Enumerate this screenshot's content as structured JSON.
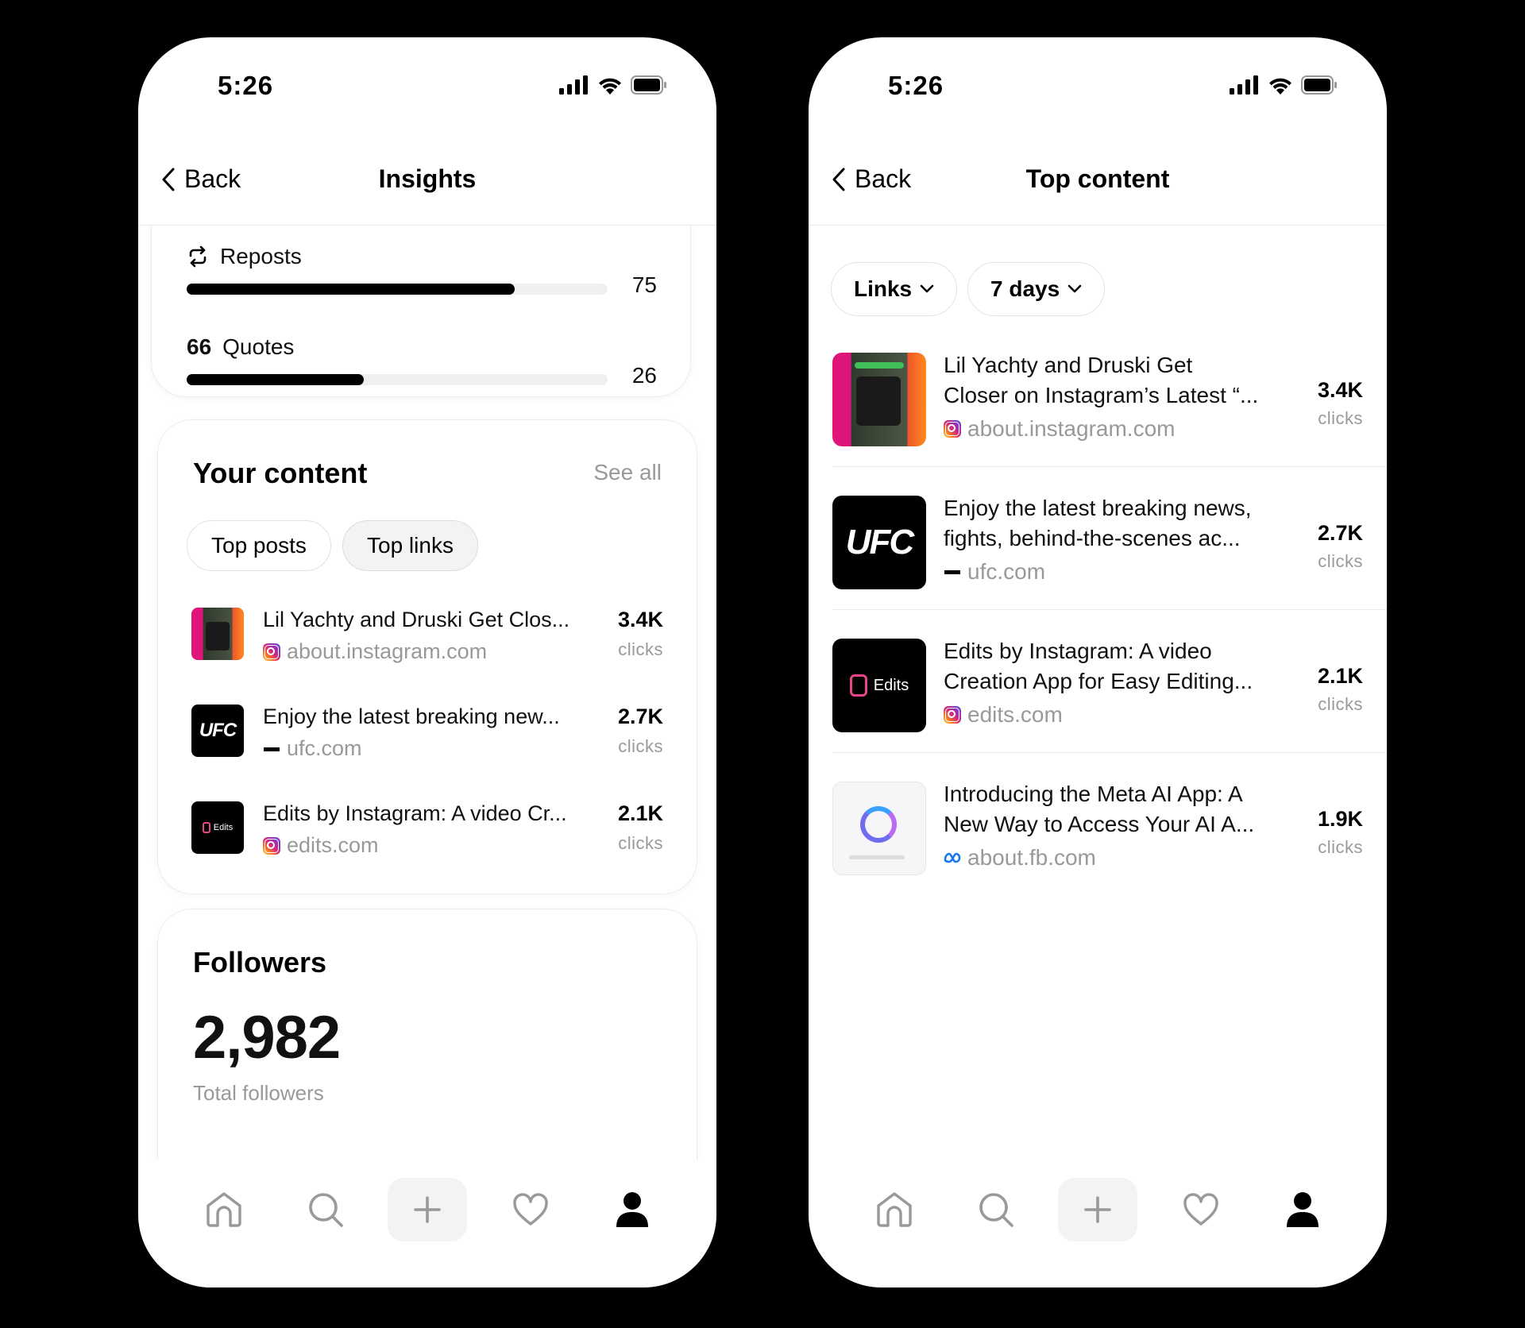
{
  "left_screen": {
    "status": {
      "time": "5:26"
    },
    "nav": {
      "back_label": "Back",
      "title": "Insights"
    },
    "interactions": {
      "reposts": {
        "label": "Reposts",
        "value": "75",
        "fraction": 0.78
      },
      "quotes": {
        "icon_text": "66",
        "label": "Quotes",
        "value": "26",
        "fraction": 0.42
      }
    },
    "your_content": {
      "title": "Your content",
      "see_all": "See all",
      "tabs": [
        {
          "label": "Top posts",
          "active": false
        },
        {
          "label": "Top links",
          "active": true
        }
      ],
      "items": [
        {
          "title": "Lil Yachty and Druski Get Clos...",
          "domain": "about.instagram.com",
          "count": "3.4K",
          "unit": "clicks",
          "thumb": "instagram-reel-thumbnail",
          "favicon": "instagram-icon"
        },
        {
          "title": "Enjoy the latest breaking new...",
          "domain": "ufc.com",
          "count": "2.7K",
          "unit": "clicks",
          "thumb": "ufc-logo",
          "favicon": "ufc-icon"
        },
        {
          "title": "Edits by Instagram: A video Cr...",
          "domain": "edits.com",
          "count": "2.1K",
          "unit": "clicks",
          "thumb": "edits-logo",
          "favicon": "instagram-icon"
        }
      ]
    },
    "followers": {
      "title": "Followers",
      "total": "2,982",
      "total_label": "Total followers"
    }
  },
  "right_screen": {
    "status": {
      "time": "5:26"
    },
    "nav": {
      "back_label": "Back",
      "title": "Top content"
    },
    "filters": [
      {
        "label": "Links"
      },
      {
        "label": "7 days"
      }
    ],
    "items": [
      {
        "line1": "Lil Yachty and Druski Get",
        "line2": "Closer on Instagram’s Latest “...",
        "domain": "about.instagram.com",
        "count": "3.4K",
        "unit": "clicks",
        "thumb": "instagram-reel-thumbnail",
        "favicon": "instagram-icon"
      },
      {
        "line1": "Enjoy the latest breaking news,",
        "line2": "fights, behind-the-scenes ac...",
        "domain": "ufc.com",
        "count": "2.7K",
        "unit": "clicks",
        "thumb": "ufc-logo",
        "favicon": "ufc-icon"
      },
      {
        "line1": "Edits by Instagram: A video",
        "line2": "Creation App for Easy Editing...",
        "domain": "edits.com",
        "count": "2.1K",
        "unit": "clicks",
        "thumb": "edits-logo",
        "favicon": "instagram-icon"
      },
      {
        "line1": "Introducing the Meta AI App: A",
        "line2": "New Way to Access Your AI A...",
        "domain": "about.fb.com",
        "count": "1.9K",
        "unit": "clicks",
        "thumb": "meta-ai-screenshot",
        "favicon": "meta-icon"
      }
    ]
  },
  "logos": {
    "ufc": "UFC",
    "edits": "Edits"
  },
  "tab_bar": [
    "home-icon",
    "search-icon",
    "create-icon",
    "activity-heart-icon",
    "profile-icon"
  ]
}
